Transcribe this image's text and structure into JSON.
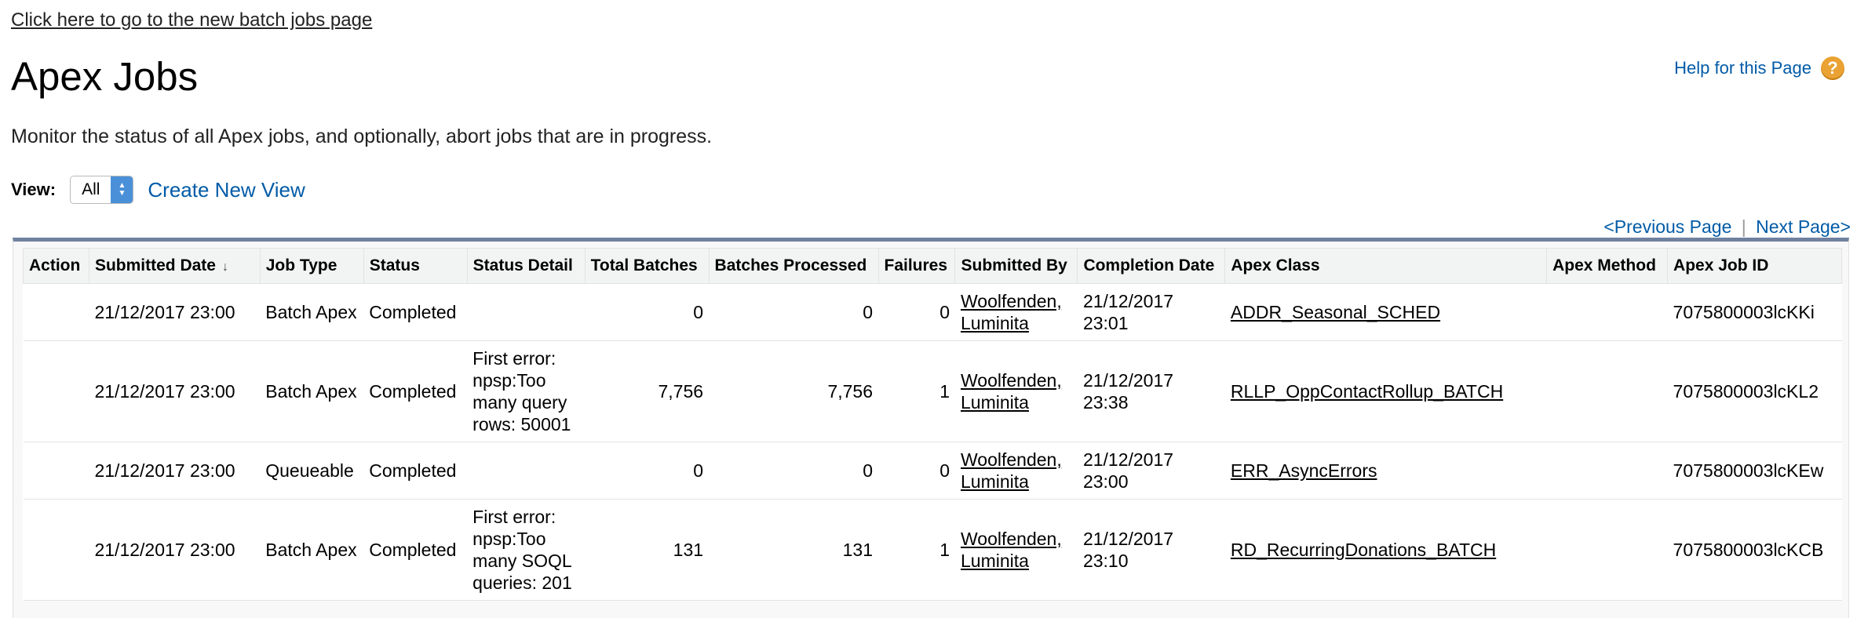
{
  "top_link": "Click here to go to the new batch jobs page",
  "page_title": "Apex Jobs",
  "help": {
    "label": "Help for this Page",
    "icon": "question-icon",
    "icon_glyph": "?"
  },
  "description": "Monitor the status of all Apex jobs, and optionally, abort jobs that are in progress.",
  "view": {
    "label": "View:",
    "selected": "All",
    "create_link": "Create New View"
  },
  "pager": {
    "previous": "<Previous Page",
    "separator": "|",
    "next": "Next Page>"
  },
  "table": {
    "sort_indicator": "↓",
    "headers": {
      "action": "Action",
      "submitted_date": "Submitted Date",
      "job_type": "Job Type",
      "status": "Status",
      "status_detail": "Status Detail",
      "total_batches": "Total Batches",
      "batches_processed": "Batches Processed",
      "failures": "Failures",
      "submitted_by": "Submitted By",
      "completion_date": "Completion Date",
      "apex_class": "Apex Class",
      "apex_method": "Apex Method",
      "apex_job_id": "Apex Job ID"
    },
    "rows": [
      {
        "action": "",
        "submitted_date": "21/12/2017 23:00",
        "job_type": "Batch Apex",
        "status": "Completed",
        "status_detail": "",
        "total_batches": "0",
        "batches_processed": "0",
        "failures": "0",
        "submitted_by": "Woolfenden, Luminita",
        "completion_date": "21/12/2017 23:01",
        "apex_class": "ADDR_Seasonal_SCHED",
        "apex_method": "",
        "apex_job_id": "7075800003lcKKi"
      },
      {
        "action": "",
        "submitted_date": "21/12/2017 23:00",
        "job_type": "Batch Apex",
        "status": "Completed",
        "status_detail": "First error: npsp:Too many query rows: 50001",
        "total_batches": "7,756",
        "batches_processed": "7,756",
        "failures": "1",
        "submitted_by": "Woolfenden, Luminita",
        "completion_date": "21/12/2017 23:38",
        "apex_class": "RLLP_OppContactRollup_BATCH",
        "apex_method": "",
        "apex_job_id": "7075800003lcKL2"
      },
      {
        "action": "",
        "submitted_date": "21/12/2017 23:00",
        "job_type": "Queueable",
        "status": "Completed",
        "status_detail": "",
        "total_batches": "0",
        "batches_processed": "0",
        "failures": "0",
        "submitted_by": "Woolfenden, Luminita",
        "completion_date": "21/12/2017 23:00",
        "apex_class": "ERR_AsyncErrors",
        "apex_method": "",
        "apex_job_id": "7075800003lcKEw"
      },
      {
        "action": "",
        "submitted_date": "21/12/2017 23:00",
        "job_type": "Batch Apex",
        "status": "Completed",
        "status_detail": "First error: npsp:Too many SOQL queries: 201",
        "total_batches": "131",
        "batches_processed": "131",
        "failures": "1",
        "submitted_by": "Woolfenden, Luminita",
        "completion_date": "21/12/2017 23:10",
        "apex_class": "RD_RecurringDonations_BATCH",
        "apex_method": "",
        "apex_job_id": "7075800003lcKCB"
      }
    ]
  }
}
